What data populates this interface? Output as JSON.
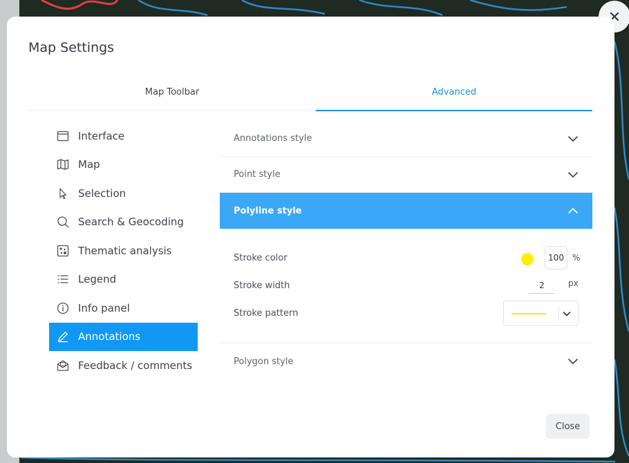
{
  "modal": {
    "title": "Map Settings",
    "close_label": "Close"
  },
  "tabs": [
    {
      "label": "Map Toolbar",
      "active": false
    },
    {
      "label": "Advanced",
      "active": true
    }
  ],
  "sidebar": {
    "items": [
      {
        "label": "Interface",
        "icon": "window-icon"
      },
      {
        "label": "Map",
        "icon": "map-icon"
      },
      {
        "label": "Selection",
        "icon": "cursor-icon"
      },
      {
        "label": "Search & Geocoding",
        "icon": "search-icon"
      },
      {
        "label": "Thematic analysis",
        "icon": "thematic-icon"
      },
      {
        "label": "Legend",
        "icon": "list-icon"
      },
      {
        "label": "Info panel",
        "icon": "info-icon"
      },
      {
        "label": "Annotations",
        "icon": "pencil-icon",
        "active": true
      },
      {
        "label": "Feedback / comments",
        "icon": "envelope-icon"
      }
    ]
  },
  "accordion": {
    "sections": [
      {
        "label": "Annotations style",
        "open": false
      },
      {
        "label": "Point style",
        "open": false
      },
      {
        "label": "Polyline style",
        "open": true
      },
      {
        "label": "Polygon style",
        "open": false
      }
    ],
    "polyline": {
      "stroke_color_label": "Stroke color",
      "stroke_color": "#ffef00",
      "stroke_opacity": "100",
      "opacity_unit": "%",
      "stroke_width_label": "Stroke width",
      "stroke_width": "2",
      "width_unit": "px",
      "stroke_pattern_label": "Stroke pattern"
    }
  },
  "colors": {
    "accent": "#1a91d4",
    "active_item": "#1098f4",
    "open_section": "#3aa8f6"
  }
}
